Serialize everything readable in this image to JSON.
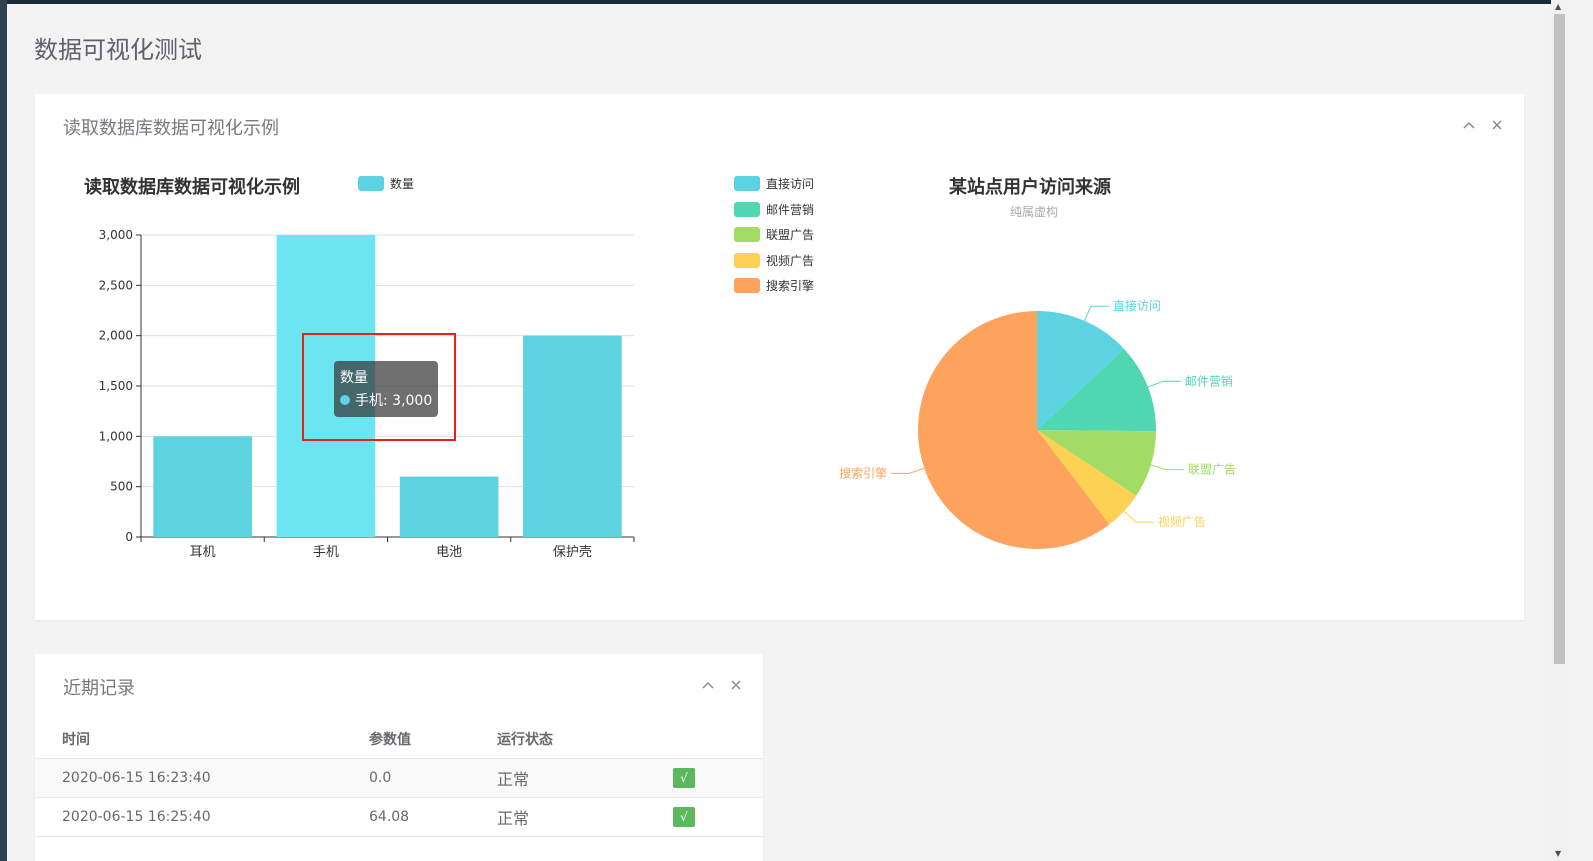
{
  "page_title": "数据可视化测试",
  "panel1": {
    "title": "读取数据库数据可视化示例",
    "collapse_icon": "chevron-up-icon",
    "close_icon": "close-icon"
  },
  "panel2": {
    "title": "近期记录",
    "collapse_icon": "chevron-up-icon",
    "close_icon": "close-icon"
  },
  "chart_data": [
    {
      "type": "bar",
      "title": "读取数据库数据可视化示例",
      "categories": [
        "耳机",
        "手机",
        "电池",
        "保护壳"
      ],
      "series": [
        {
          "name": "数量",
          "values": [
            1000,
            3000,
            600,
            2000
          ],
          "color": "#5dd2e0"
        }
      ],
      "ylim": [
        0,
        3000
      ],
      "yticks": [
        "0",
        "500",
        "1,000",
        "1,500",
        "2,000",
        "2,500",
        "3,000"
      ],
      "legend": "top",
      "grid": true,
      "tooltip": {
        "title": "数量",
        "text": "手机: 3,000"
      }
    },
    {
      "type": "pie",
      "title": "某站点用户访问来源",
      "subtitle": "纯属虚构",
      "legend": "left",
      "slices": [
        {
          "name": "直接访问",
          "value": 335,
          "color": "#5dd2e0"
        },
        {
          "name": "邮件营销",
          "value": 310,
          "color": "#50d6b1"
        },
        {
          "name": "联盟广告",
          "value": 234,
          "color": "#a2dc65"
        },
        {
          "name": "视频广告",
          "value": 135,
          "color": "#fdd154"
        },
        {
          "name": "搜索引擎",
          "value": 1548,
          "color": "#fda35d"
        }
      ]
    }
  ],
  "records": {
    "columns": [
      "时间",
      "参数值",
      "运行状态",
      ""
    ],
    "rows": [
      {
        "time": "2020-06-15 16:23:40",
        "value": "0.0",
        "status": "正常",
        "badge": "√"
      },
      {
        "time": "2020-06-15 16:25:40",
        "value": "64.08",
        "status": "正常",
        "badge": "√"
      }
    ]
  },
  "colors": {
    "accent": "#5dd2e0",
    "badge": "#5cb85c",
    "highlight": "#e5201f"
  }
}
